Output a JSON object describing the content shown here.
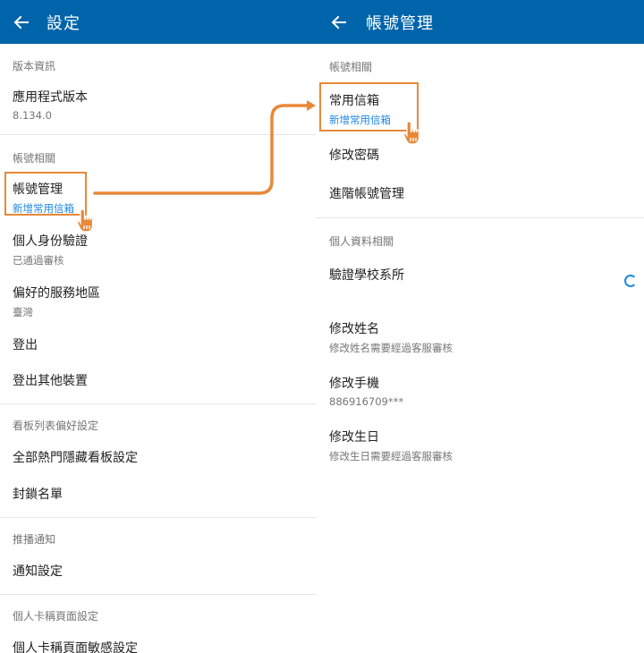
{
  "left": {
    "title": "設定",
    "sections": {
      "version": {
        "header": "版本資訊",
        "app_version_label": "應用程式版本",
        "app_version_value": "8.134.0"
      },
      "account": {
        "header": "帳號相關",
        "account_mgmt_label": "帳號管理",
        "account_mgmt_sub": "新增常用信箱",
        "identity_label": "個人身份驗證",
        "identity_sub": "已通過審核",
        "region_label": "偏好的服務地區",
        "region_sub": "臺灣",
        "logout_label": "登出",
        "logout_others_label": "登出其他裝置"
      },
      "board": {
        "header": "看板列表偏好設定",
        "hide_hot_label": "全部熱門隱藏看板設定",
        "block_list_label": "封鎖名單"
      },
      "push": {
        "header": "推播通知",
        "notify_settings_label": "通知設定"
      },
      "card": {
        "header": "個人卡稱頁面設定",
        "sensitive_label": "個人卡稱頁面敏感設定"
      }
    }
  },
  "right": {
    "title": "帳號管理",
    "sections": {
      "account": {
        "header": "帳號相關",
        "email_label": "常用信箱",
        "email_sub": "新增常用信箱",
        "password_label": "修改密碼",
        "advanced_label": "進階帳號管理"
      },
      "personal": {
        "header": "個人資料相關",
        "school_label": "驗證學校系所",
        "name_label": "修改姓名",
        "name_sub": "修改姓名需要經過客服審核",
        "phone_label": "修改手機",
        "phone_sub": "886916709***",
        "birthday_label": "修改生日",
        "birthday_sub": "修改生日需要經過客服審核"
      }
    }
  },
  "colors": {
    "appbar": "#0064aa",
    "highlight": "#e8883a",
    "link": "#1e88e5"
  },
  "icons": [
    "back-arrow-icon",
    "pointing-hand-icon",
    "loading-spinner-icon",
    "arrow-connector-icon"
  ]
}
